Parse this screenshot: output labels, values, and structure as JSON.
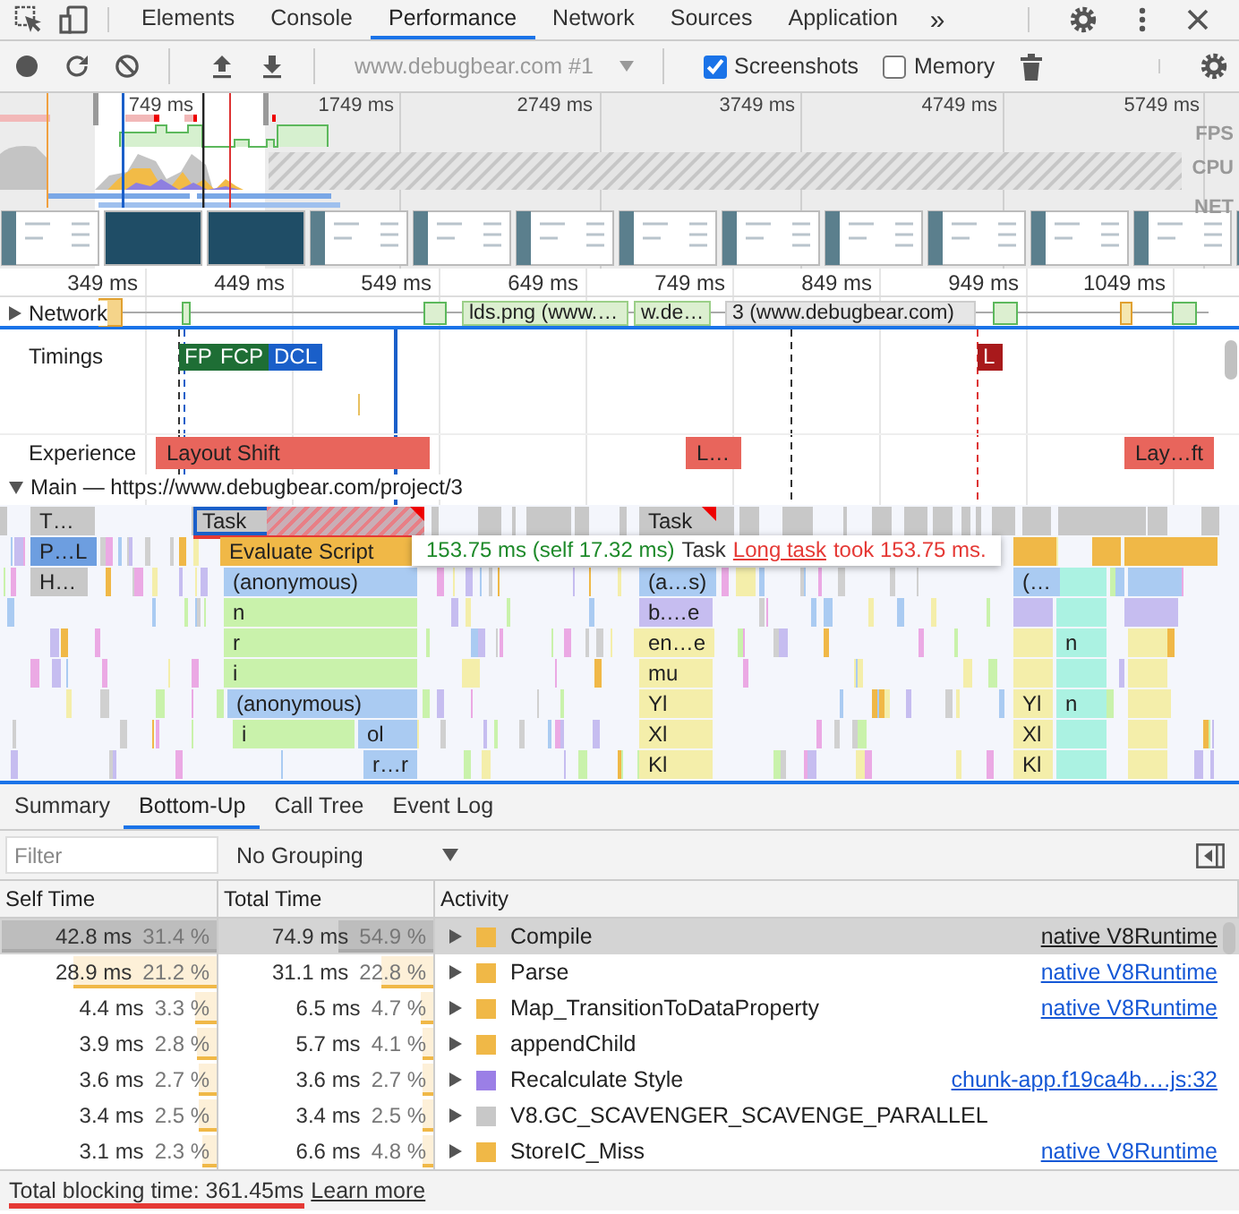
{
  "tabs": [
    {
      "label": "Elements",
      "selected": false
    },
    {
      "label": "Console",
      "selected": false
    },
    {
      "label": "Performance",
      "selected": true
    },
    {
      "label": "Network",
      "selected": false
    },
    {
      "label": "Sources",
      "selected": false
    },
    {
      "label": "Application",
      "selected": false
    }
  ],
  "tabs_overflow": "»",
  "toolbar": {
    "target": "www.debugbear.com #1",
    "options": [
      {
        "label": "Screenshots",
        "checked": true
      },
      {
        "label": "Memory",
        "checked": false
      }
    ]
  },
  "overview": {
    "ticks": [
      "749 ms",
      "1749 ms",
      "2749 ms",
      "3749 ms",
      "4749 ms",
      "5749 ms"
    ],
    "tracks": [
      "FPS",
      "CPU",
      "NET"
    ]
  },
  "ruler": [
    "349 ms",
    "449 ms",
    "549 ms",
    "649 ms",
    "749 ms",
    "849 ms",
    "949 ms",
    "1049 ms"
  ],
  "network": {
    "label": "Network",
    "expanded": false,
    "requests": [
      "lds.png (www.…",
      "w.de…",
      "3 (www.debugbear.com)"
    ]
  },
  "timings": {
    "label": "Timings",
    "markers": [
      {
        "label": "FP",
        "color": "#1e6e35"
      },
      {
        "label": "FCP",
        "color": "#1e6e35"
      },
      {
        "label": "DCL",
        "color": "#1a5fc9"
      },
      {
        "label": "L",
        "color": "#a8191b"
      }
    ]
  },
  "experience": {
    "label": "Experience",
    "shifts": [
      "Layout Shift",
      "L…",
      "Lay…ft"
    ]
  },
  "main": {
    "label": "Main — https://www.debugbear.com/project/3",
    "expanded": true,
    "entries": [
      {
        "label": "T…",
        "color": "#c8c8c8",
        "selected": false,
        "long_task": false,
        "underlined": false
      },
      {
        "label": "Task",
        "color": "#c8c8c8",
        "selected": true,
        "long_task": true,
        "underlined": true
      },
      {
        "label": "Task",
        "color": "#c8c8c8",
        "selected": false,
        "long_task": true,
        "underlined": false
      },
      {
        "label": "P…L",
        "color": "#6d9ee0",
        "selected": false,
        "long_task": false,
        "underlined": false
      },
      {
        "label": "Evaluate Script",
        "color": "#f0b847",
        "selected": false,
        "long_task": false,
        "underlined": false
      },
      {
        "label": "H…",
        "color": "#c8c8c8",
        "selected": false,
        "long_task": false,
        "underlined": false
      },
      {
        "label": "(anonymous)",
        "color": "#aacbf2",
        "selected": false,
        "long_task": false,
        "underlined": false
      },
      {
        "label": "(a…s)",
        "color": "#aacbf2",
        "selected": false,
        "long_task": false,
        "underlined": false
      },
      {
        "label": "(…",
        "color": "#aacbf2",
        "selected": false,
        "long_task": false,
        "underlined": false
      },
      {
        "label": "n",
        "color": "#c9f2ab",
        "selected": false,
        "long_task": false,
        "underlined": false
      },
      {
        "label": "b.…e",
        "color": "#c6bdf0",
        "selected": false,
        "long_task": false,
        "underlined": false
      },
      {
        "label": "r",
        "color": "#c9f2ab",
        "selected": false,
        "long_task": false,
        "underlined": false
      },
      {
        "label": "en…e",
        "color": "#f4eeaa",
        "selected": false,
        "long_task": false,
        "underlined": false
      },
      {
        "label": "n",
        "color": "#abf2e2",
        "selected": false,
        "long_task": false,
        "underlined": false
      },
      {
        "label": "i",
        "color": "#c9f2ab",
        "selected": false,
        "long_task": false,
        "underlined": false
      },
      {
        "label": "mu",
        "color": "#f4eeaa",
        "selected": false,
        "long_task": false,
        "underlined": false
      },
      {
        "label": "(anonymous)",
        "color": "#aacbf2",
        "selected": false,
        "long_task": false,
        "underlined": false
      },
      {
        "label": "Yl",
        "color": "#f4eeaa",
        "selected": false,
        "long_task": false,
        "underlined": false
      },
      {
        "label": "Yl",
        "color": "#f4eeaa",
        "selected": false,
        "long_task": false,
        "underlined": false
      },
      {
        "label": "n",
        "color": "#abf2e2",
        "selected": false,
        "long_task": false,
        "underlined": false
      },
      {
        "label": "i",
        "color": "#c9f2ab",
        "selected": false,
        "long_task": false,
        "underlined": false
      },
      {
        "label": "ol",
        "color": "#aacbf2",
        "selected": false,
        "long_task": false,
        "underlined": false
      },
      {
        "label": "Xl",
        "color": "#f4eeaa",
        "selected": false,
        "long_task": false,
        "underlined": false
      },
      {
        "label": "Xl",
        "color": "#f4eeaa",
        "selected": false,
        "long_task": false,
        "underlined": false
      },
      {
        "label": "r…r",
        "color": "#aacbf2",
        "selected": false,
        "long_task": false,
        "underlined": false
      },
      {
        "label": "Kl",
        "color": "#f4eeaa",
        "selected": false,
        "long_task": false,
        "underlined": false
      },
      {
        "label": "Kl",
        "color": "#f4eeaa",
        "selected": false,
        "long_task": false,
        "underlined": false
      }
    ]
  },
  "tooltip": {
    "duration": "153.75 ms (self 17.32 ms)",
    "name": "Task",
    "warning_link": "Long task",
    "warning_text": "took 153.75 ms."
  },
  "details_tabs": [
    {
      "label": "Summary",
      "selected": false
    },
    {
      "label": "Bottom-Up",
      "selected": true
    },
    {
      "label": "Call Tree",
      "selected": false
    },
    {
      "label": "Event Log",
      "selected": false
    }
  ],
  "filter": {
    "placeholder": "Filter"
  },
  "grouping": "No Grouping",
  "columns": [
    "Self Time",
    "Total Time",
    "Activity"
  ],
  "rows": [
    {
      "self": {
        "time": "42.8 ms",
        "share": "31.4 %",
        "level": 0.99
      },
      "total": {
        "time": "74.9 ms",
        "share": "54.9 %",
        "level": 0.44
      },
      "activity": "Compile",
      "color": "#f0b847",
      "source": "native V8Runtime",
      "expanded": false,
      "selected": true
    },
    {
      "self": {
        "time": "28.9 ms",
        "share": "21.2 %",
        "level": 0.66
      },
      "total": {
        "time": "31.1 ms",
        "share": "22.8 %",
        "level": 0.24
      },
      "activity": "Parse",
      "color": "#f0b847",
      "source": "native V8Runtime",
      "expanded": false,
      "selected": false
    },
    {
      "self": {
        "time": "4.4 ms",
        "share": "3.3 %",
        "level": 0.1
      },
      "total": {
        "time": "6.5 ms",
        "share": "4.7 %",
        "level": 0.06
      },
      "activity": "Map_TransitionToDataProperty",
      "color": "#f0b847",
      "source": "native V8Runtime",
      "expanded": false,
      "selected": false
    },
    {
      "self": {
        "time": "3.9 ms",
        "share": "2.8 %",
        "level": 0.09
      },
      "total": {
        "time": "5.7 ms",
        "share": "4.1 %",
        "level": 0.05
      },
      "activity": "appendChild",
      "color": "#f0b847",
      "expanded": false,
      "selected": false
    },
    {
      "self": {
        "time": "3.6 ms",
        "share": "2.7 %",
        "level": 0.08
      },
      "total": {
        "time": "3.6 ms",
        "share": "2.7 %",
        "level": 0.05
      },
      "activity": "Recalculate Style",
      "color": "#9b7fe6",
      "source": "chunk-app.f19ca4b….js:32",
      "expanded": false,
      "selected": false
    },
    {
      "self": {
        "time": "3.4 ms",
        "share": "2.5 %",
        "level": 0.08
      },
      "total": {
        "time": "3.4 ms",
        "share": "2.5 %",
        "level": 0.05
      },
      "activity": "V8.GC_SCAVENGER_SCAVENGE_PARALLEL",
      "color": "#c8c8c8",
      "expanded": false,
      "selected": false
    },
    {
      "self": {
        "time": "3.1 ms",
        "share": "2.3 %",
        "level": 0.07
      },
      "total": {
        "time": "6.6 ms",
        "share": "4.8 %",
        "level": 0.05
      },
      "activity": "StoreIC_Miss",
      "color": "#f0b847",
      "source": "native V8Runtime",
      "expanded": false,
      "selected": false
    }
  ],
  "status": {
    "text": "Total blocking time: 361.45ms",
    "underlined": true,
    "link": "Learn more"
  }
}
